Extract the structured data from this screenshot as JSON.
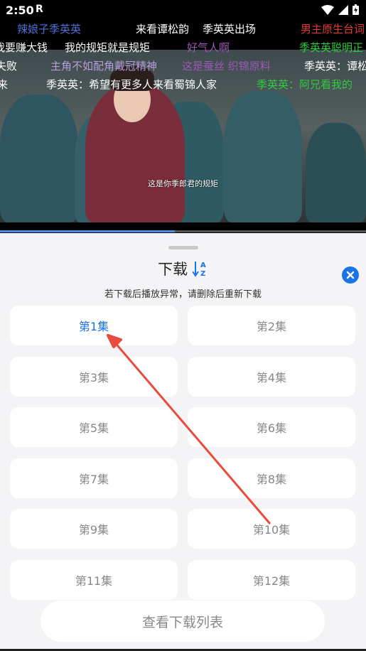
{
  "status": {
    "time": "2:50",
    "logo": "R"
  },
  "danmaku": [
    {
      "text": "辣娘子季英英",
      "color": "#4f6fd6"
    },
    {
      "text": "来看谭松韵",
      "color": "#ffffff"
    },
    {
      "text": "季英英出场",
      "color": "#ffffff"
    },
    {
      "text": "男主原生台词",
      "color": "#e53935"
    },
    {
      "text": "我要赚大钱",
      "color": "#ffffff"
    },
    {
      "text": "我的规矩就是规矩",
      "color": "#ffffff"
    },
    {
      "text": "好气人啊",
      "color": "#9b59b6"
    },
    {
      "text": "季英英聪明正",
      "color": "#2ecc40"
    },
    {
      "text": "失败",
      "color": "#ffffff"
    },
    {
      "text": "主角不如配角戴冠精神",
      "color": "#b39ddb"
    },
    {
      "text": "这是蚕丝 织锦原料",
      "color": "#9b59b6"
    },
    {
      "text": "季英英：谭松",
      "color": "#ffffff"
    },
    {
      "text": "来",
      "color": "#ffffff"
    },
    {
      "text": "季英英：希望有更多人来看蜀锦人家",
      "color": "#ffffff"
    },
    {
      "text": "季英英：阿兄看我的",
      "color": "#2ecc40"
    }
  ],
  "video": {
    "subtitle": "这是你季郎君的规矩",
    "progress": 0.478
  },
  "sheet": {
    "title": "下载",
    "sort_icon_text": "↓AZ",
    "hint": "若下载后播放异常，请删除后重新下载",
    "episodes": [
      "第1集",
      "第2集",
      "第3集",
      "第4集",
      "第5集",
      "第6集",
      "第7集",
      "第8集",
      "第9集",
      "第10集",
      "第11集",
      "第12集"
    ],
    "selected_episode": "第1集",
    "view_list_label": "查看下载列表"
  },
  "colors": {
    "accent": "#1a73e8",
    "arrow": "#e74c3c"
  }
}
